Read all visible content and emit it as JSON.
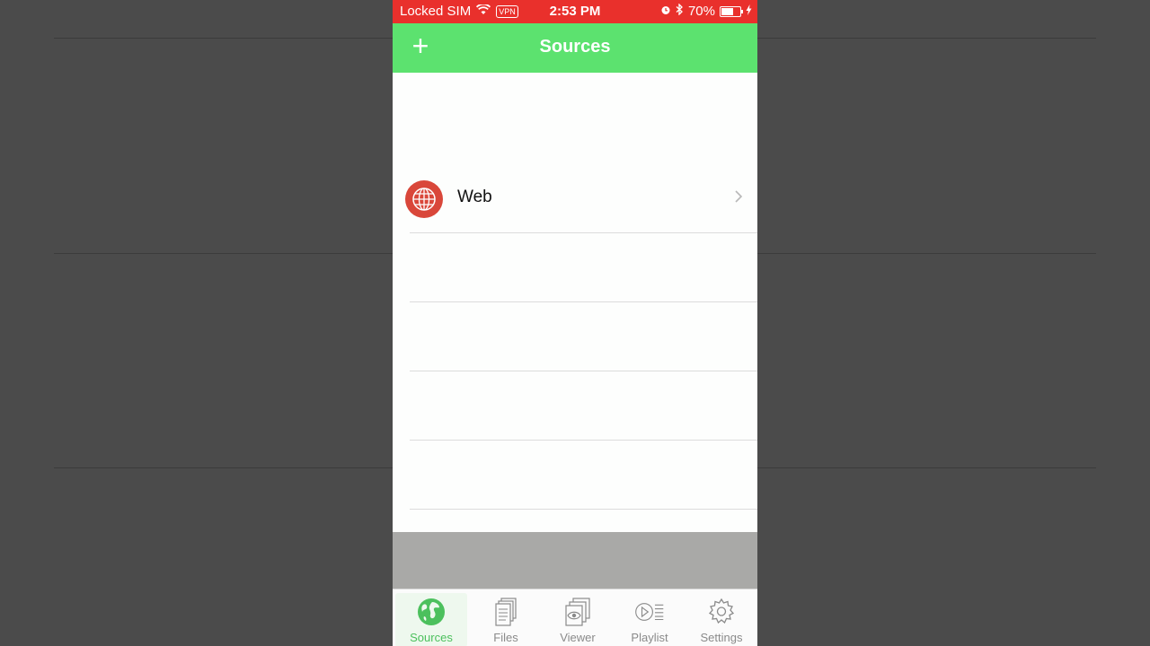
{
  "status_bar": {
    "carrier": "Locked SIM",
    "vpn": "VPN",
    "time": "2:53 PM",
    "battery_percent": "70%",
    "battery_level": 0.7
  },
  "nav": {
    "add_symbol": "+",
    "title": "Sources"
  },
  "sources": [
    {
      "label": "Web",
      "icon": "globe-icon"
    }
  ],
  "tabs": [
    {
      "label": "Sources",
      "icon": "earth-icon",
      "active": true
    },
    {
      "label": "Files",
      "icon": "files-icon",
      "active": false
    },
    {
      "label": "Viewer",
      "icon": "viewer-icon",
      "active": false
    },
    {
      "label": "Playlist",
      "icon": "playlist-icon",
      "active": false
    },
    {
      "label": "Settings",
      "icon": "gear-icon",
      "active": false
    }
  ],
  "colors": {
    "status_bar": "#e9302c",
    "nav_bar": "#5ce26f",
    "accent": "#4cc05d",
    "web_icon": "#d9473a"
  }
}
